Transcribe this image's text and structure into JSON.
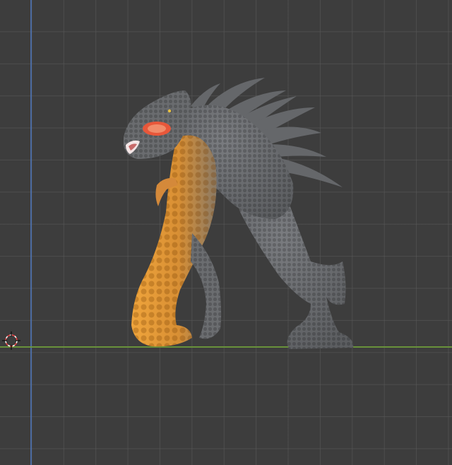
{
  "viewport": {
    "grid": "on",
    "colors": {
      "background": "#3d3d3d",
      "grid_line": "#5a5a5a",
      "axis_y": "#4d73b3",
      "axis_x": "#6d9a3a",
      "model_body": "#6f7174",
      "model_highlight": "#e8a03a",
      "eye_glow": "#e8573a"
    },
    "cursor_icon": "3d-cursor-icon",
    "model": "creature-sculpt"
  }
}
